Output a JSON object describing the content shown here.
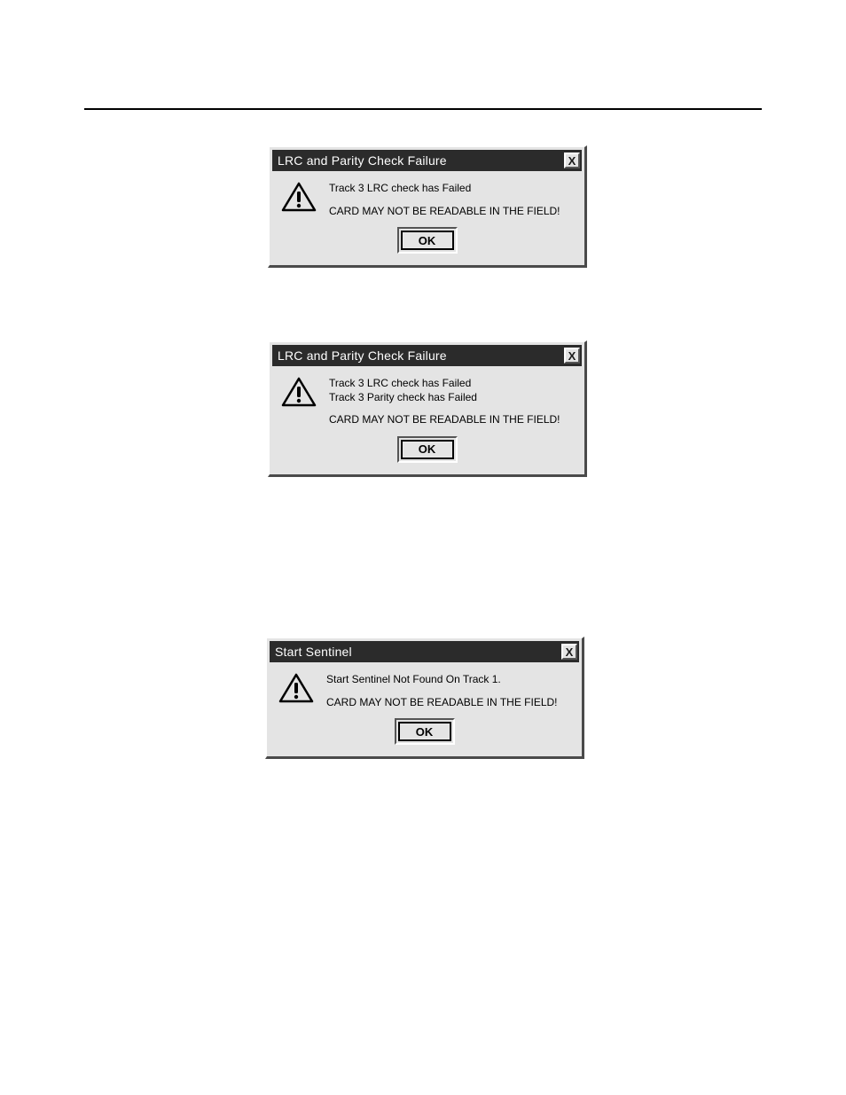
{
  "dialogs": [
    {
      "title": "LRC and Parity Check Failure",
      "title_bold": false,
      "close": "X",
      "messages": [
        "Track 3 LRC check has Failed"
      ],
      "warning": "CARD MAY NOT BE READABLE IN THE FIELD!",
      "ok": "OK"
    },
    {
      "title": "LRC and Parity Check Failure",
      "title_bold": false,
      "close": "X",
      "messages": [
        "Track 3 LRC check has Failed",
        "Track 3 Parity check has Failed"
      ],
      "warning": "CARD MAY NOT BE READABLE IN THE FIELD!",
      "ok": "OK"
    },
    {
      "title": "Start Sentinel",
      "title_bold": true,
      "close": "X",
      "messages": [
        "Start Sentinel Not Found On Track  1."
      ],
      "warning": "CARD MAY NOT BE READABLE IN THE FIELD!",
      "ok": "OK"
    }
  ]
}
